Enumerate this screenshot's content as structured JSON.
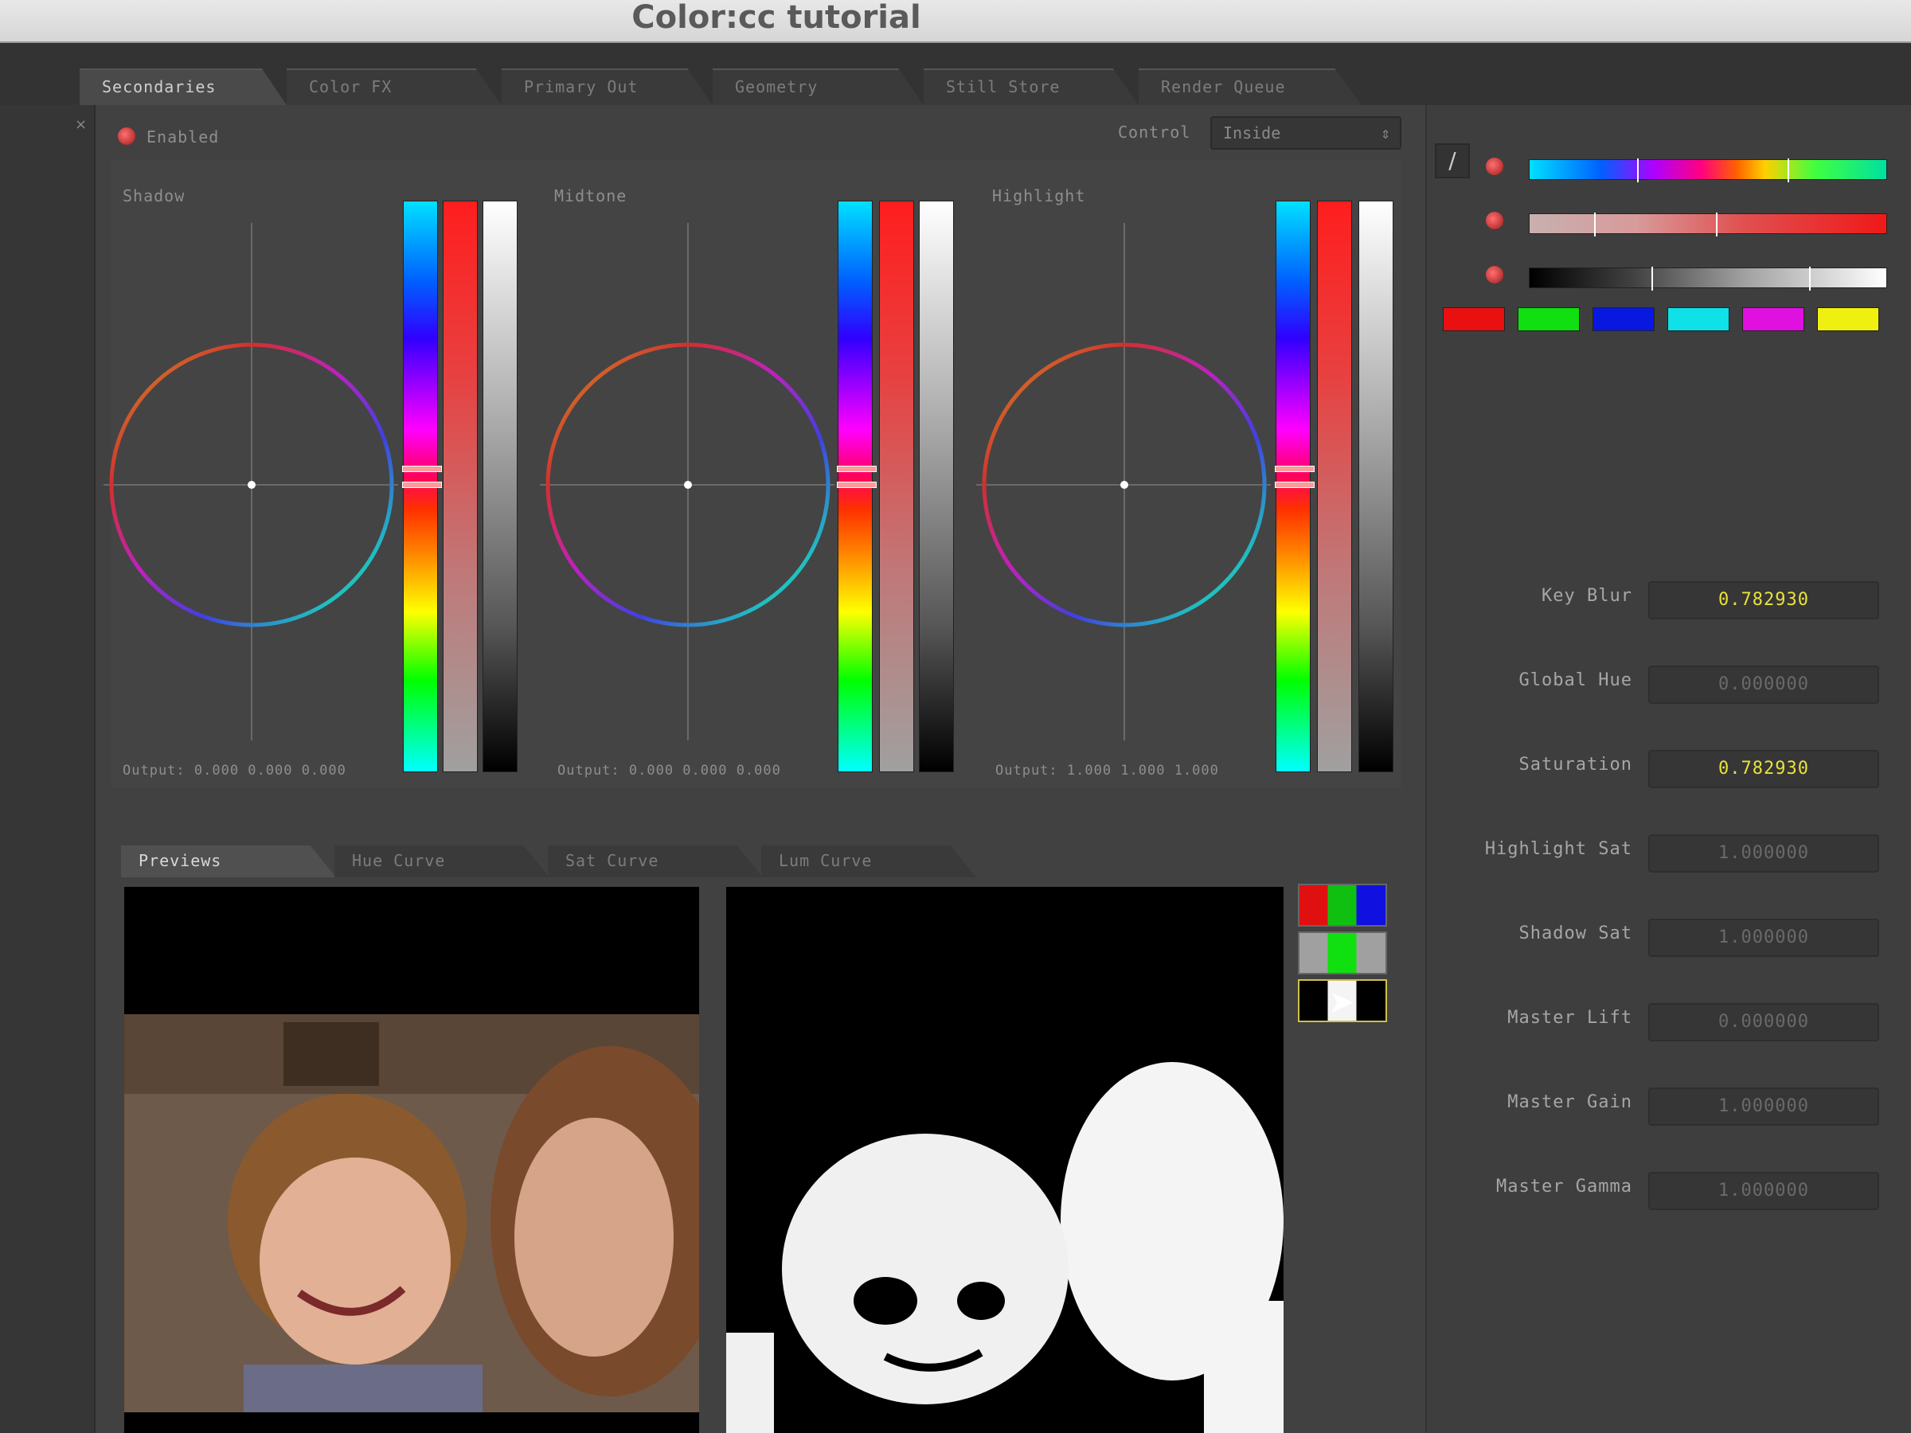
{
  "window": {
    "title": "Color:cc tutorial"
  },
  "main_tabs": [
    {
      "label": "Secondaries",
      "active": true
    },
    {
      "label": "Color FX",
      "active": false
    },
    {
      "label": "Primary Out",
      "active": false
    },
    {
      "label": "Geometry",
      "active": false
    },
    {
      "label": "Still Store",
      "active": false
    },
    {
      "label": "Render Queue",
      "active": false
    }
  ],
  "left_strip": {
    "close_glyph": "×"
  },
  "secondaries": {
    "enabled_label": "Enabled",
    "enable_icon": "red-dot-icon",
    "control_label": "Control",
    "control_value": "Inside",
    "wheels": [
      {
        "label": "Shadow",
        "output": "Output: 0.000 0.000 0.000"
      },
      {
        "label": "Midtone",
        "output": "Output: 0.000 0.000 0.000"
      },
      {
        "label": "Highlight",
        "output": "Output: 1.000 1.000 1.000"
      }
    ]
  },
  "preview_tabs": [
    {
      "label": "Previews",
      "active": true
    },
    {
      "label": "Hue Curve",
      "active": false
    },
    {
      "label": "Sat Curve",
      "active": false
    },
    {
      "label": "Lum Curve",
      "active": false
    }
  ],
  "preview": {
    "left_image": "color-preview-mother-and-child",
    "right_image": "matte-preview-mother-and-child",
    "view_buttons": [
      "rgb-view-button",
      "green-view-button",
      "matte-view-button"
    ]
  },
  "qualifiers": {
    "eyedropper_icon": "eyedropper-icon",
    "ranges": [
      {
        "name": "H",
        "handles": [
          0.3,
          0.72
        ]
      },
      {
        "name": "S",
        "handles": [
          0.18,
          0.52
        ]
      },
      {
        "name": "L",
        "handles": [
          0.34,
          0.78
        ]
      }
    ],
    "swatches": [
      "#e81010",
      "#10e010",
      "#0818e0",
      "#10e0e8",
      "#e010e0",
      "#f0f010"
    ]
  },
  "parameters": [
    {
      "label": "Key Blur",
      "value": "0.782930",
      "highlight": true
    },
    {
      "label": "Global Hue",
      "value": "0.000000",
      "highlight": false
    },
    {
      "label": "Saturation",
      "value": "0.782930",
      "highlight": true
    },
    {
      "label": "Highlight Sat",
      "value": "1.000000",
      "highlight": false
    },
    {
      "label": "Shadow Sat",
      "value": "1.000000",
      "highlight": false
    },
    {
      "label": "Master Lift",
      "value": "0.000000",
      "highlight": false
    },
    {
      "label": "Master Gain",
      "value": "1.000000",
      "highlight": false
    },
    {
      "label": "Master Gamma",
      "value": "1.000000",
      "highlight": false
    }
  ],
  "colors": {
    "accent_value": "#e8e23a",
    "panel": "#414141"
  }
}
